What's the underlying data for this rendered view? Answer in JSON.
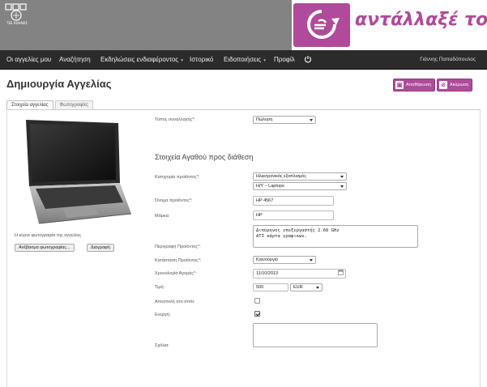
{
  "header": {
    "logo_text": "ΤΕΕ ΑΘΗΝΑΣ",
    "brand_name": "αντάλλαξέ το!",
    "brand_color": "#b04a9a"
  },
  "nav": {
    "items": [
      {
        "label": "Οι αγγελίες μου"
      },
      {
        "label": "Αναζήτηση"
      },
      {
        "label": "Εκδηλώσεις ενδιαφέροντος"
      },
      {
        "label": "Ιστορικό"
      },
      {
        "label": "Ειδοποιήσεις"
      },
      {
        "label": "Προφίλ"
      }
    ],
    "power_icon": "power-icon",
    "user_name": "Γιάννης Παπαδόπουλος"
  },
  "page": {
    "title": "Δημιουργία Αγγελίας",
    "save_label": "Αποθήκευση",
    "cancel_label": "Ακύρωση"
  },
  "tabs": [
    {
      "label": "Στοιχεία αγγελίας",
      "active": true
    },
    {
      "label": "Φωτογραφίες",
      "active": false
    }
  ],
  "photo": {
    "caption": "Η κύρια φωτογραφία της αγγελίας",
    "upload_label": "Ανέβασμα φωτογραφίας...",
    "delete_label": "Διαγραφή"
  },
  "form": {
    "transaction_type_label": "Τύπος συναλλαγής*:",
    "transaction_type_value": "Πώληση",
    "section_title": "Στοιχεία Αγαθού προς διάθεση",
    "category_label": "Κατηγορία προϊόντος*:",
    "category_value": "Ηλεκτρονικός εξοπλισμός",
    "subcategory_value": "Η/Υ – Laptops",
    "product_name_label": "Όνομα προϊόντος*:",
    "product_name_value": "HP 4567",
    "brand_label": "Μάρκα:",
    "brand_value": "HP",
    "description_label": "Περιγραφή Προϊόντος*:",
    "description_line1": "Διπύρηνος επεξεργαστής 2.66 GHz",
    "description_line2": "ATI κάρτα γραφικών.",
    "condition_label": "Κατάσταση Προϊόντος*:",
    "condition_value": "Καινούργιο",
    "purchase_date_label": "Χρονολογία Αγοράς*:",
    "purchase_date_value": "11/10/2013",
    "price_label": "Τιμή:",
    "price_value": "500",
    "currency_value": "EUR",
    "shipping_label": "Αποστολή στο σπίτι:",
    "shipping_checked": false,
    "active_label": "Ενεργή:",
    "active_checked": true,
    "comments_label": "Σχόλια:",
    "comments_value": ""
  }
}
